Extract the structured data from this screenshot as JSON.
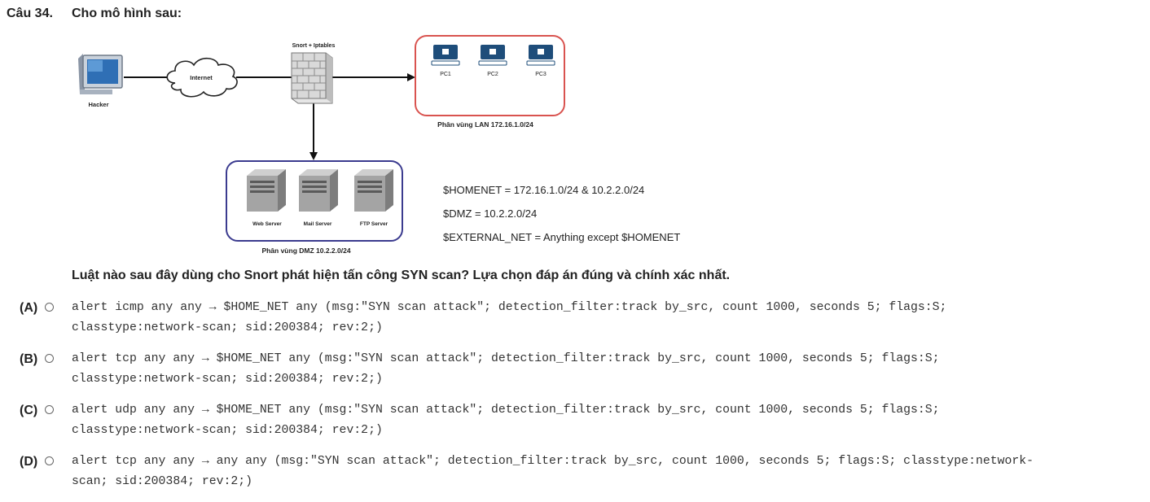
{
  "question": {
    "number": "Câu 34.",
    "intro": "Cho mô hình sau:",
    "prompt": "Luật nào sau đây dùng cho Snort phát hiện tấn công SYN scan? Lựa chọn đáp án đúng và chính xác nhất."
  },
  "diagram": {
    "hacker": "Hacker",
    "internet": "Internet",
    "firewall": "Snort + Iptables",
    "lan_pcs": [
      "PC1",
      "PC2",
      "PC3"
    ],
    "lan_zone": "Phân vùng LAN 172.16.1.0/24",
    "dmz_servers": [
      "Web Server",
      "Mail Server",
      "FTP Server"
    ],
    "dmz_zone": "Phân vùng DMZ 10.2.2.0/24",
    "colors": {
      "lan_border": "#d9534f",
      "dmz_border": "#3b3b8f"
    }
  },
  "definitions": [
    "$HOMENET = 172.16.1.0/24 & 10.2.2.0/24",
    "$DMZ = 10.2.2.0/24",
    "$EXTERNAL_NET = Anything except $HOMENET"
  ],
  "options": [
    {
      "label": "(A)",
      "line1": "alert icmp any any → $HOME_NET any (msg:\"SYN scan attack\"; detection_filter:track by_src, count 1000, seconds 5; flags:S;",
      "line2": "classtype:network-scan; sid:200384; rev:2;)"
    },
    {
      "label": "(B)",
      "line1": "alert tcp any any → $HOME_NET any (msg:\"SYN scan attack\"; detection_filter:track by_src, count 1000, seconds 5; flags:S;",
      "line2": "classtype:network-scan; sid:200384; rev:2;)"
    },
    {
      "label": "(C)",
      "line1": "alert udp any any → $HOME_NET any (msg:\"SYN scan attack\"; detection_filter:track by_src, count 1000, seconds 5; flags:S;",
      "line2": "classtype:network-scan; sid:200384; rev:2;)"
    },
    {
      "label": "(D)",
      "line1": "alert tcp any any → any any (msg:\"SYN scan attack\"; detection_filter:track by_src, count 1000, seconds 5; flags:S; classtype:network-",
      "line2": "scan; sid:200384; rev:2;)"
    }
  ]
}
